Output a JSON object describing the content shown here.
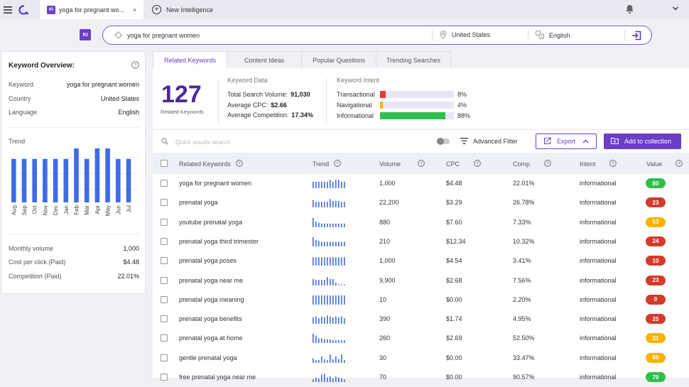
{
  "topbar": {
    "tab_badge": "KI",
    "tab_title": "yoga for pregnant wo...",
    "tab_close": "×",
    "new_tab_label": "New Intelligence"
  },
  "search": {
    "badge": "KI",
    "query": "yoga for pregnant women",
    "country": "United States",
    "language": "English"
  },
  "overview": {
    "title": "Keyword Overview:",
    "rows": [
      {
        "k": "Keyword",
        "v": "yoga for pregnant women"
      },
      {
        "k": "Country",
        "v": "United States"
      },
      {
        "k": "Language",
        "v": "English"
      }
    ],
    "trend_label": "Trend",
    "trend": {
      "months": [
        "Aug",
        "Sep",
        "Oct",
        "Nov",
        "Dec",
        "Jan",
        "Feb",
        "Mar",
        "Apr",
        "May",
        "Jun",
        "Jul"
      ],
      "values": [
        0.68,
        0.68,
        0.68,
        0.68,
        0.68,
        0.68,
        0.87,
        0.68,
        0.87,
        0.87,
        0.68,
        0.68
      ]
    },
    "metrics": [
      {
        "k": "Monthly volume",
        "v": "1,000"
      },
      {
        "k": "Cost per click (Paid)",
        "v": "$4.48"
      },
      {
        "k": "Competition (Paid)",
        "v": "22.01%"
      }
    ]
  },
  "tabs": [
    "Related Keywords",
    "Content Ideas",
    "Popular Questions",
    "Trending Searches"
  ],
  "summary": {
    "count": "127",
    "count_label": "Related Keywords",
    "kd_title": "Keyword Data",
    "kd_rows": [
      {
        "k": "Total Search Volume:",
        "v": "91,030"
      },
      {
        "k": "Average CPC:",
        "v": "$2.66"
      },
      {
        "k": "Average Competition:",
        "v": "17.34%"
      }
    ],
    "ki_title": "Keyword Intent",
    "ki_rows": [
      {
        "k": "Transactional",
        "pct": "8%",
        "frac": 0.08,
        "color": "#e03c31"
      },
      {
        "k": "Navigational",
        "pct": "4%",
        "frac": 0.04,
        "color": "#f5b400"
      },
      {
        "k": "Informational",
        "pct": "88%",
        "frac": 0.88,
        "color": "#2ec04a"
      }
    ]
  },
  "toolbar": {
    "search_placeholder": "Quick results search",
    "advanced_filter": "Advanced Filter",
    "export": "Export",
    "add_collection": "Add to collection"
  },
  "table": {
    "headers": [
      "Related Keywords",
      "Trend",
      "Volume",
      "CPC",
      "Comp",
      "Intent",
      "Value"
    ],
    "rows": [
      {
        "kw": "yoga for pregnant women",
        "vol": "1,000",
        "cpc": "$4.48",
        "comp": "22.01%",
        "intent": "informational",
        "value": "80",
        "color": "#2ec04a",
        "trend": [
          0.7,
          0.7,
          0.7,
          0.7,
          0.7,
          0.7,
          0.9,
          0.7,
          0.9,
          0.9,
          0.7,
          0.7
        ]
      },
      {
        "kw": "prenatal yoga",
        "vol": "22,200",
        "cpc": "$3.29",
        "comp": "26.78%",
        "intent": "informational",
        "value": "23",
        "color": "#d33a2c",
        "trend": [
          0.8,
          0.6,
          0.6,
          0.6,
          0.6,
          0.6,
          0.9,
          0.7,
          0.7,
          0.7,
          0.6,
          0.6
        ]
      },
      {
        "kw": "youtube prenatal yoga",
        "vol": "880",
        "cpc": "$7.60",
        "comp": "7.33%",
        "intent": "informational",
        "value": "53",
        "color": "#f5b400",
        "trend": [
          1.0,
          0.6,
          0.5,
          0.4,
          0.4,
          0.4,
          0.4,
          0.4,
          0.4,
          0.4,
          0.4,
          0.4
        ]
      },
      {
        "kw": "prenatal yoga third trimester",
        "vol": "210",
        "cpc": "$12.34",
        "comp": "10.32%",
        "intent": "informational",
        "value": "24",
        "color": "#d33a2c",
        "trend": [
          1.0,
          0.7,
          0.6,
          0.5,
          0.5,
          0.5,
          0.5,
          0.5,
          0.5,
          0.5,
          0.5,
          0.5
        ]
      },
      {
        "kw": "prenatal yoga poses",
        "vol": "1,000",
        "cpc": "$4.54",
        "comp": "3.41%",
        "intent": "informational",
        "value": "10",
        "color": "#d33a2c",
        "trend": [
          0.9,
          0.9,
          0.9,
          0.9,
          0.9,
          0.9,
          0.9,
          0.9,
          0.9,
          0.9,
          0.9,
          0.9
        ]
      },
      {
        "kw": "prenatal yoga near me",
        "vol": "9,900",
        "cpc": "$2.68",
        "comp": "7.56%",
        "intent": "informational",
        "value": "23",
        "color": "#d33a2c",
        "trend": [
          0.7,
          0.6,
          0.6,
          0.6,
          0.6,
          0.9,
          0.7,
          0.7,
          0.3,
          0.1,
          0.1,
          0.1
        ]
      },
      {
        "kw": "prenatal yoga meaning",
        "vol": "10",
        "cpc": "$0.00",
        "comp": "2.20%",
        "intent": "informational",
        "value": "0",
        "color": "#d33a2c",
        "trend": [
          1,
          1,
          1,
          1,
          1,
          1,
          1,
          1,
          1,
          1,
          1,
          1
        ]
      },
      {
        "kw": "prenatal yoga benefits",
        "vol": "390",
        "cpc": "$1.74",
        "comp": "4.95%",
        "intent": "informational",
        "value": "25",
        "color": "#d33a2c",
        "trend": [
          0.7,
          0.8,
          0.6,
          0.8,
          0.7,
          0.9,
          0.8,
          0.7,
          0.8,
          0.7,
          0.8,
          0.6
        ]
      },
      {
        "kw": "prenatal yoga at home",
        "vol": "260",
        "cpc": "$2.69",
        "comp": "52.50%",
        "intent": "informational",
        "value": "31",
        "color": "#f5b400",
        "trend": [
          1.0,
          0.8,
          0.5,
          0.5,
          0.4,
          0.4,
          0.4,
          0.3,
          0.3,
          0.3,
          0.3,
          0.3
        ]
      },
      {
        "kw": "gentle prenatal yoga",
        "vol": "30",
        "cpc": "$0.00",
        "comp": "33.47%",
        "intent": "informational",
        "value": "66",
        "color": "#f5b400",
        "trend": [
          0.5,
          0.3,
          0.3,
          0.7,
          0.4,
          0.3,
          0.9,
          0.4,
          0.7,
          0.4,
          0.9,
          0.3
        ]
      },
      {
        "kw": "free prenatal yoga near me",
        "vol": "70",
        "cpc": "$0.00",
        "comp": "90.57%",
        "intent": "informational",
        "value": "70",
        "color": "#2ec04a",
        "trend": [
          0.3,
          0.5,
          0.4,
          0.8,
          0.9,
          0.5,
          0.6,
          0.4,
          0.6,
          0.5,
          0.4,
          0.3
        ]
      }
    ]
  }
}
